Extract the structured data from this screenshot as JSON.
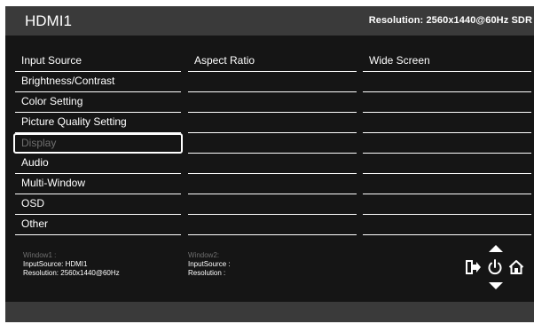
{
  "header": {
    "input_name": "HDMI1",
    "resolution": "Resolution: 2560x1440@60Hz SDR"
  },
  "menu": {
    "items": [
      {
        "label": "Input Source",
        "state": "normal"
      },
      {
        "label": "Brightness/Contrast",
        "state": "normal"
      },
      {
        "label": "Color Setting",
        "state": "normal"
      },
      {
        "label": "Picture Quality Setting",
        "state": "normal"
      },
      {
        "label": "Display",
        "state": "selected"
      },
      {
        "label": "Audio",
        "state": "normal"
      },
      {
        "label": "Multi-Window",
        "state": "normal"
      },
      {
        "label": "OSD",
        "state": "normal"
      },
      {
        "label": "Other",
        "state": "normal"
      }
    ]
  },
  "submenu": {
    "items": [
      "Aspect Ratio",
      "",
      "",
      "",
      "",
      "",
      "",
      "",
      ""
    ]
  },
  "values": {
    "items": [
      "Wide Screen",
      "",
      "",
      "",
      "",
      "",
      "",
      "",
      ""
    ]
  },
  "window1": {
    "heading": "Window1 :",
    "input_source": "InputSource: HDMI1",
    "resolution": "Resolution: 2560x1440@60Hz"
  },
  "window2": {
    "heading": "Window2:",
    "input_source": "InputSource :",
    "resolution": "Resolution :"
  },
  "icons": {
    "up": "triangle-up-icon",
    "down": "triangle-down-icon",
    "exit": "exit-icon",
    "power": "power-icon",
    "home": "home-icon"
  },
  "colors": {
    "background": "#151515",
    "bar": "#3a3a3a",
    "text": "#ffffff",
    "disabled": "#6f6f6f"
  }
}
